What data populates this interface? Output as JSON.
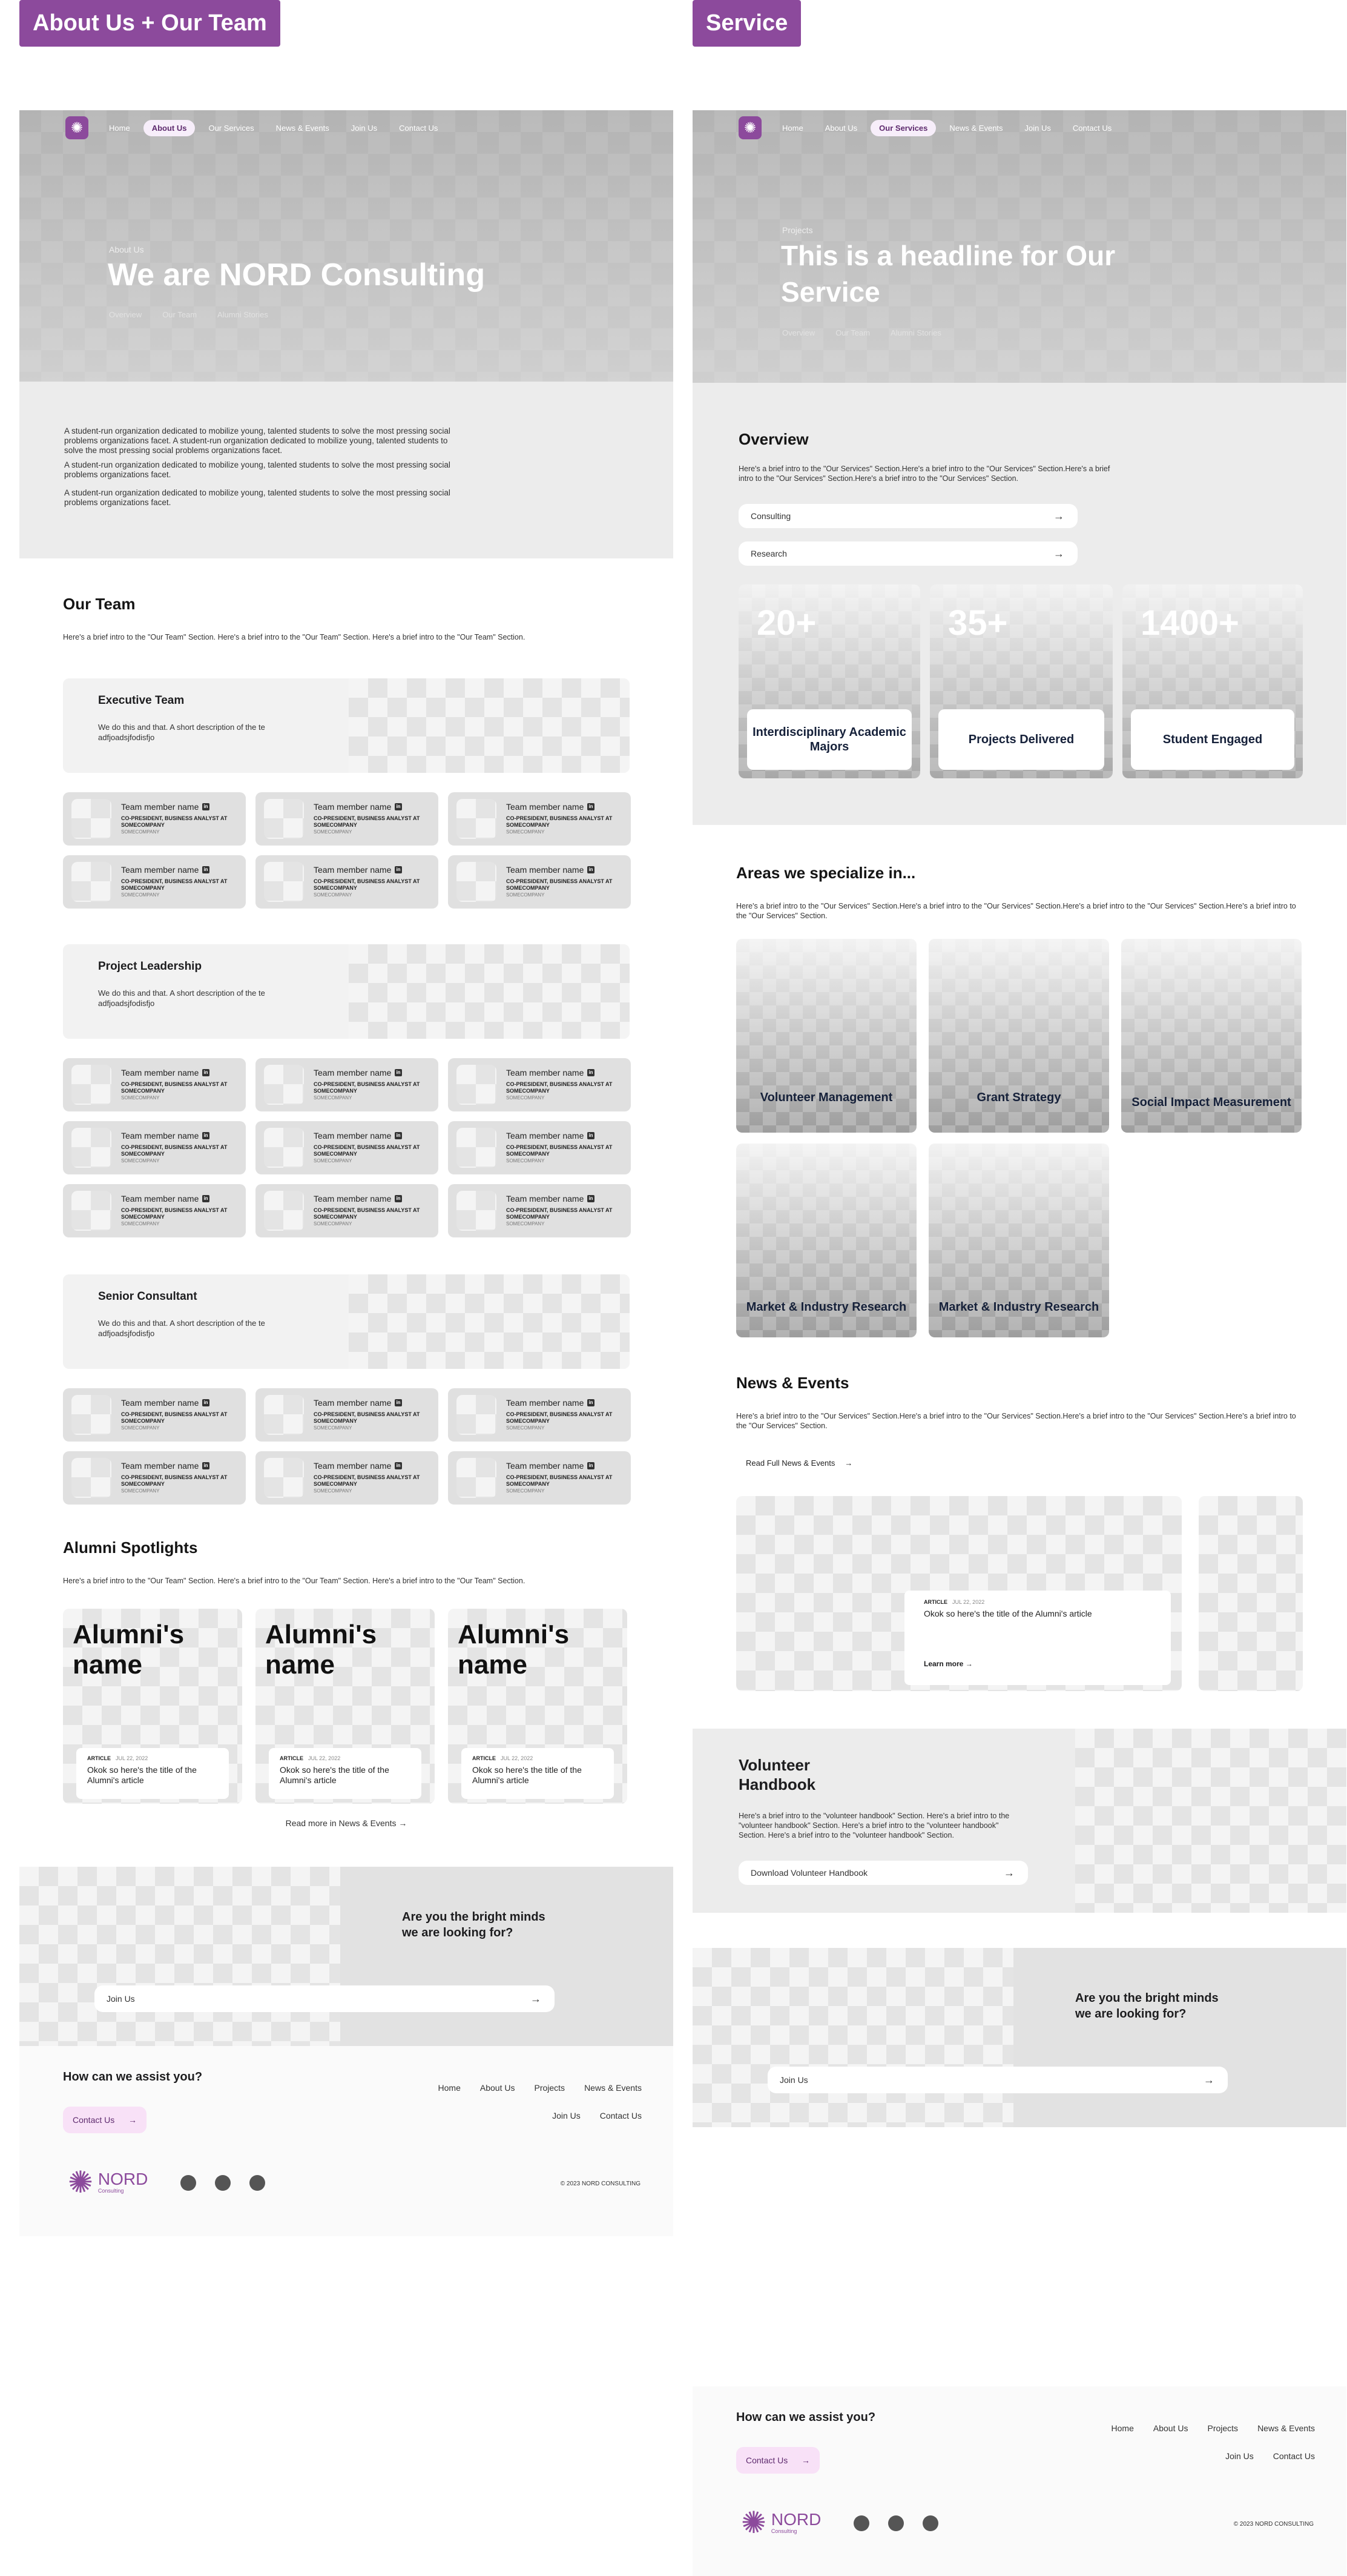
{
  "labels": {
    "left": "About Us + Our Team",
    "right": "Service"
  },
  "nav": {
    "items": [
      "Home",
      "About Us",
      "Our Services",
      "News & Events",
      "Join Us",
      "Contact Us"
    ]
  },
  "about": {
    "hero": {
      "eyebrow": "About Us",
      "title": "We are NORD Consulting",
      "subnav": [
        "Overview",
        "Our Team",
        "Alumni Stories"
      ]
    },
    "intro": [
      "A student-run organization dedicated to mobilize young, talented students to solve the most pressing social problems organizations facet. A student-run organization dedicated to mobilize young, talented students to solve the most pressing social problems organizations facet.",
      "A student-run organization dedicated to mobilize young, talented students to solve the most pressing social problems organizations facet.",
      "A student-run organization dedicated to mobilize young, talented students to solve the most pressing social problems organizations facet."
    ],
    "team_title": "Our Team",
    "team_intro": "Here's a brief intro to the \"Our Team\" Section. Here's a brief intro to the \"Our Team\" Section. Here's a brief intro to the \"Our Team\" Section.",
    "groups": [
      {
        "title": "Executive Team",
        "desc": "We do this and that. A short description of the te adfjoadsjfodisfjo"
      },
      {
        "title": "Project Leadership",
        "desc": "We do this and that. A short description of the te adfjoadsjfodisfjo"
      },
      {
        "title": "Senior Consultant",
        "desc": "We do this and that. A short description of the te adfjoadsjfodisfjo"
      }
    ],
    "member": {
      "name": "Team member name",
      "linkedin": "in",
      "role": "CO-PRESIDENT, BUSINESS ANALYST AT SOMECOMPANY",
      "company": "SOMECOMPANY"
    },
    "alumni_title": "Alumni Spotlights",
    "alumni_intro": "Here's a brief intro to the \"Our Team\" Section. Here's a brief intro to the \"Our Team\" Section. Here's a brief intro to the \"Our Team\" Section.",
    "alumni": [
      {
        "name": "Alumni's name",
        "tag": "ARTICLE",
        "date": "JUL 22, 2022",
        "title": "Okok so here's the title of the Alumni's article"
      },
      {
        "name": "Alumni's name",
        "tag": "ARTICLE",
        "date": "JUL 22, 2022",
        "title": "Okok so here's the title of the Alumni's article"
      },
      {
        "name": "Alumni's name",
        "tag": "ARTICLE",
        "date": "JUL 22, 2022",
        "title": "Okok so here's the title of the Alumni's article"
      }
    ],
    "read_more": "Read more in News & Events →",
    "cta": {
      "title": "Are you the bright minds we are looking for?",
      "button": "Join Us"
    }
  },
  "service": {
    "hero": {
      "eyebrow": "Projects",
      "title": "This is a headline for Our Service",
      "subnav": [
        "Overview",
        "Our Team",
        "Alumni Stories"
      ]
    },
    "overview_title": "Overview",
    "overview_intro": "Here's a brief intro to the \"Our Services\" Section.Here's a brief intro to the \"Our Services\" Section.Here's a brief intro to the \"Our Services\" Section.Here's a brief intro to the \"Our Services\" Section.",
    "pills": [
      "Consulting",
      "Research"
    ],
    "stats": [
      {
        "num": "20+",
        "label": "Interdisciplinary Academic Majors"
      },
      {
        "num": "35+",
        "label": "Projects Delivered"
      },
      {
        "num": "1400+",
        "label": "Student Engaged"
      }
    ],
    "areas_title": "Areas we specialize in...",
    "areas_intro": "Here's a brief intro to the \"Our Services\" Section.Here's a brief intro to the \"Our Services\" Section.Here's a brief intro to the \"Our Services\" Section.Here's a brief intro to the \"Our Services\" Section.",
    "areas": [
      "Volunteer Management",
      "Grant Strategy",
      "Social Impact Measurement",
      "Market & Industry Research",
      "Market & Industry Research"
    ],
    "news_title": "News & Events",
    "news_intro": "Here's a brief intro to the \"Our Services\" Section.Here's a brief intro to the \"Our Services\" Section.Here's a brief intro to the \"Our Services\" Section.Here's a brief intro to the \"Our Services\" Section.",
    "news_link": "Read Full News & Events",
    "news_card": {
      "tag": "ARTICLE",
      "date": "JUL 22, 2022",
      "title": "Okok so here's the title of the Alumni's article",
      "cta": "Learn more →"
    },
    "handbook": {
      "title": "Volunteer Handbook",
      "desc": "Here's a brief intro to the \"volunteer handbook\" Section. Here's a brief intro to the \"volunteer handbook\" Section.  Here's a brief intro to the \"volunteer handbook\" Section. Here's a brief intro to the \"volunteer handbook\" Section.",
      "button": "Download Volunteer Handbook"
    },
    "cta": {
      "title": "Are you the bright minds we are looking for?",
      "button": "Join Us"
    }
  },
  "footer": {
    "question": "How can we assist you?",
    "contact": "Contact Us",
    "links": [
      "Home",
      "About Us",
      "Projects",
      "News & Events",
      "Join Us",
      "Contact Us"
    ],
    "brand": "NORD",
    "brand_sub": "Consulting",
    "copyright": "© 2023 NORD CONSULTING"
  },
  "colors": {
    "brand": "#8c4a9c",
    "contact_bg": "#f8e1f7"
  }
}
